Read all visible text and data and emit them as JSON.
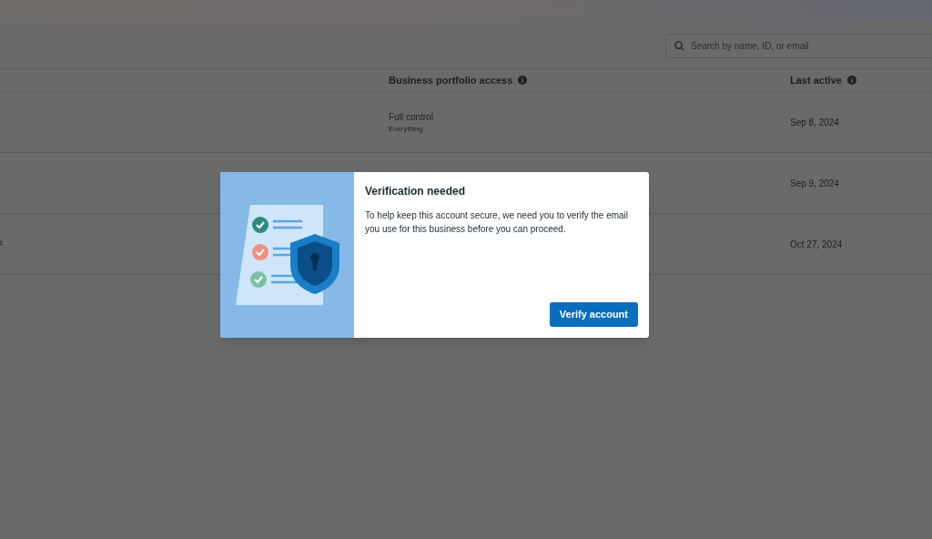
{
  "search": {
    "placeholder": "Search by name, ID, or email"
  },
  "table": {
    "columns": [
      {
        "label": "Business portfolio access"
      },
      {
        "label": "Last active"
      }
    ],
    "rows": [
      {
        "column_1": "",
        "access": "Full control",
        "access_detail": "Everything",
        "last_active": "Sep 8, 2024"
      },
      {
        "column_1": "",
        "access": "",
        "access_detail": "",
        "last_active": "Sep 9, 2024"
      },
      {
        "column_1": "t",
        "access": "",
        "access_detail": "",
        "last_active": "Oct 27, 2024"
      }
    ]
  },
  "dialog": {
    "title": "Verification needed",
    "body": "To help keep this account secure, we need you to verify the email you use for this business before you can proceed.",
    "button": "Verify account"
  }
}
